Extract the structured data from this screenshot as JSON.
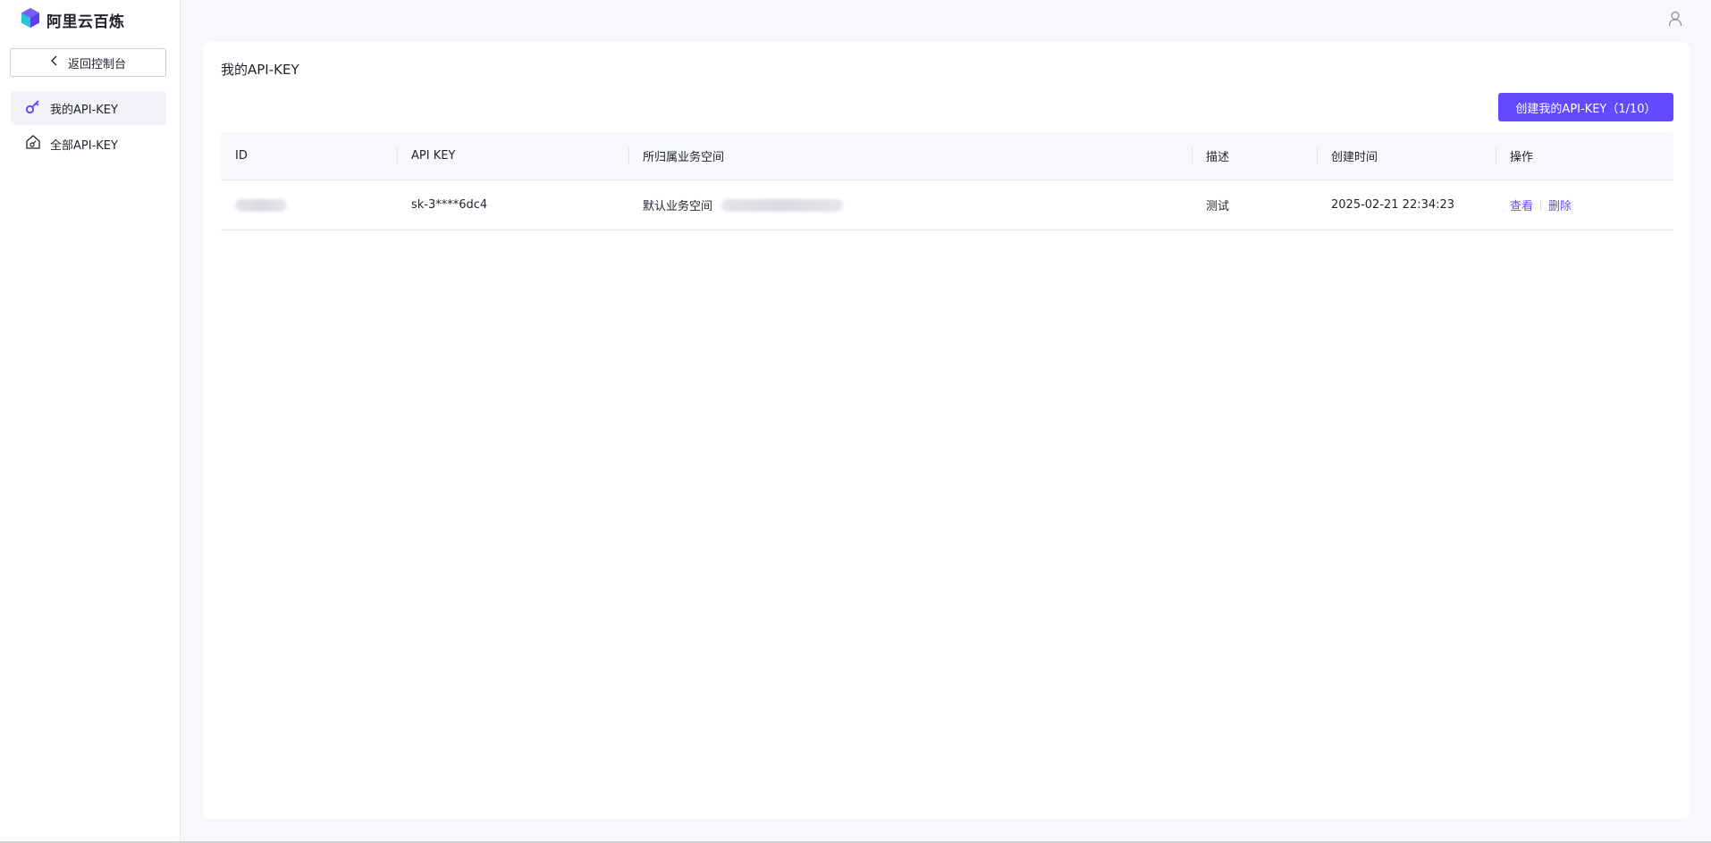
{
  "brand": {
    "name": "阿里云百炼"
  },
  "sidebar": {
    "back_label": "返回控制台",
    "items": [
      {
        "label": "我的API-KEY",
        "icon": "key-icon",
        "active": true
      },
      {
        "label": "全部API-KEY",
        "icon": "house-key-icon",
        "active": false
      }
    ]
  },
  "header": {
    "user_icon": "user-icon"
  },
  "main": {
    "title": "我的API-KEY",
    "create_button": "创建我的API-KEY（1/10）",
    "table": {
      "columns": [
        "ID",
        "API KEY",
        "所归属业务空间",
        "描述",
        "创建时间",
        "操作"
      ],
      "rows": [
        {
          "id": "",
          "api_key": "sk-3****6dc4",
          "workspace": "默认业务空间",
          "description": "测试",
          "created": "2025-02-21 22:34:23",
          "actions": [
            "查看",
            "删除"
          ]
        }
      ]
    }
  },
  "colors": {
    "accent": "#624aff",
    "background": "#f7f8fc"
  }
}
